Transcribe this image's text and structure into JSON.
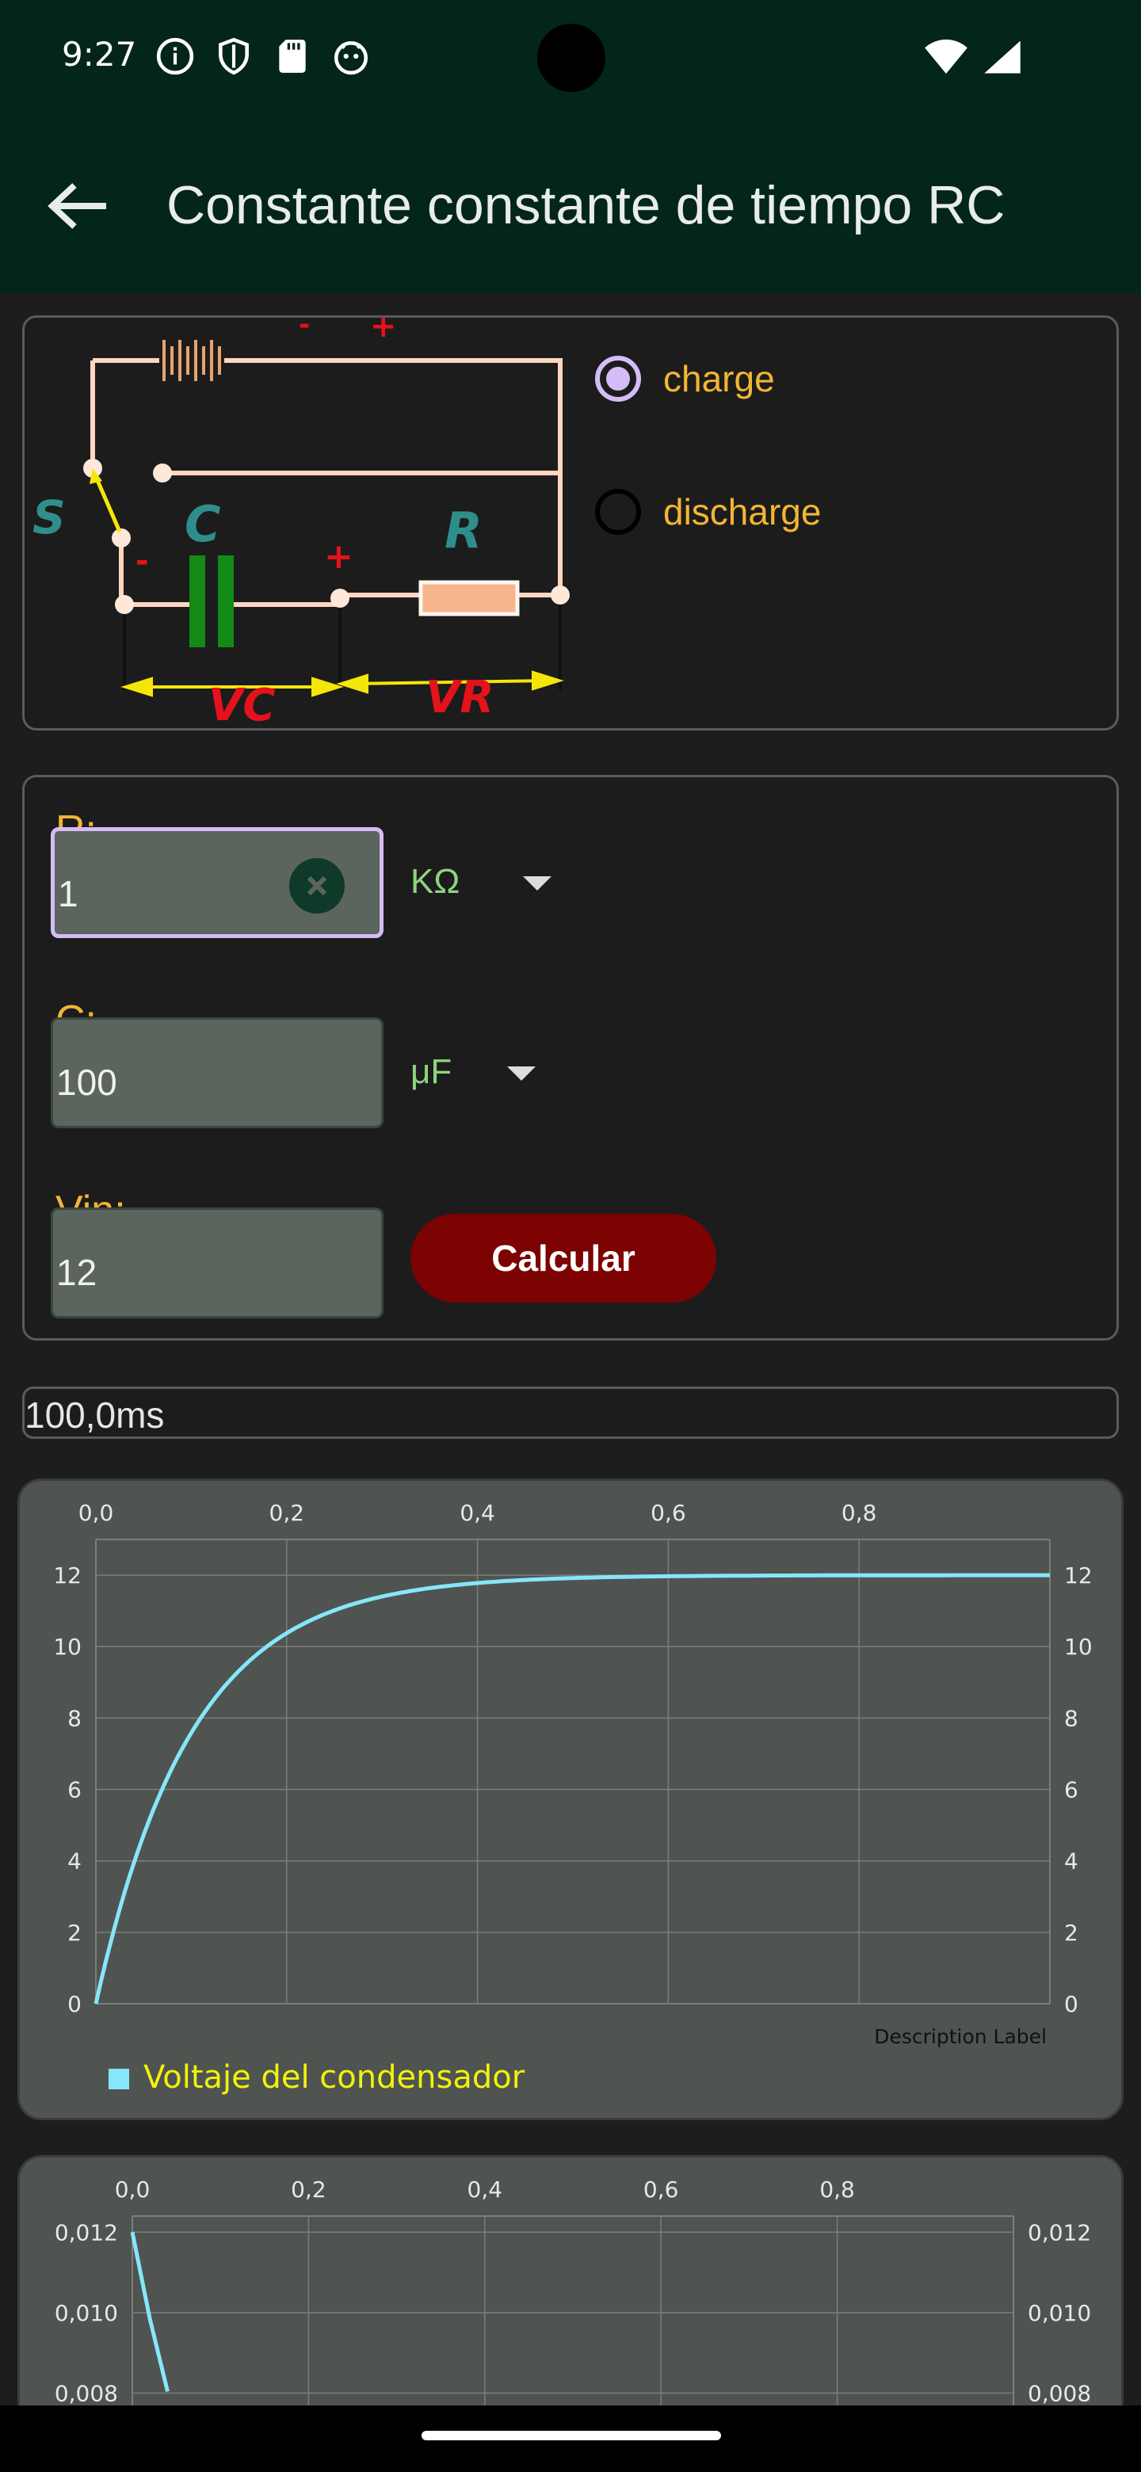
{
  "status_bar": {
    "time": "9:27"
  },
  "app_bar": {
    "title": "Constante constante de tiempo RC"
  },
  "circuit": {
    "labels": {
      "minus_top": "-",
      "plus_top": "+",
      "switch": "S",
      "capacitor": "C",
      "resistor": "R",
      "cap_minus": "-",
      "cap_plus": "+",
      "vc": "VC",
      "vr": "VR"
    }
  },
  "mode": {
    "options": [
      {
        "label": "charge",
        "selected": true
      },
      {
        "label": "discharge",
        "selected": false
      }
    ]
  },
  "form": {
    "r": {
      "label": "R:",
      "value": "1",
      "unit": "KΩ"
    },
    "c": {
      "label": "C:",
      "value": "100",
      "unit": "μF"
    },
    "vin": {
      "label": "Vin:",
      "value": "12"
    },
    "calculate_label": "Calcular"
  },
  "result": {
    "text": "100,0ms"
  },
  "colors": {
    "accent_radio": "#d4bdf7",
    "label_orange": "#f3b533",
    "unit_green": "#8ed47e",
    "button_red": "#7d0202",
    "series_cyan": "#86e6fa",
    "legend_yellow": "#f2f20a"
  },
  "chart_data": [
    {
      "type": "line",
      "x_ticks": [
        "0,0",
        "0,2",
        "0,4",
        "0,6",
        "0,8"
      ],
      "y_ticks": [
        "0",
        "2",
        "4",
        "6",
        "8",
        "10",
        "12"
      ],
      "xlim": [
        0,
        1.0
      ],
      "ylim": [
        0,
        13
      ],
      "grid": true,
      "description": "Description Label",
      "series": [
        {
          "name": "Voltaje del condensador",
          "x": [
            0,
            0.02,
            0.04,
            0.06,
            0.08,
            0.1,
            0.12,
            0.15,
            0.2,
            0.25,
            0.3,
            0.4,
            0.5,
            0.6,
            0.7,
            0.8,
            0.9,
            1.0
          ],
          "y": [
            0,
            2.18,
            3.96,
            5.41,
            6.61,
            7.59,
            8.39,
            9.32,
            10.38,
            11.01,
            11.4,
            11.78,
            11.92,
            11.97,
            11.99,
            12.0,
            12.0,
            12.0
          ]
        }
      ]
    },
    {
      "type": "line",
      "x_ticks": [
        "0,0",
        "0,2",
        "0,4",
        "0,6",
        "0,8"
      ],
      "y_ticks": [
        "0,008",
        "0,010",
        "0,012"
      ],
      "xlim": [
        0,
        1.0
      ],
      "ylim": [
        0.0072,
        0.0124
      ],
      "grid": true,
      "series": [
        {
          "x": [
            0,
            0.02,
            0.04
          ],
          "y": [
            0.012,
            0.00984,
            0.00804
          ]
        }
      ]
    }
  ]
}
